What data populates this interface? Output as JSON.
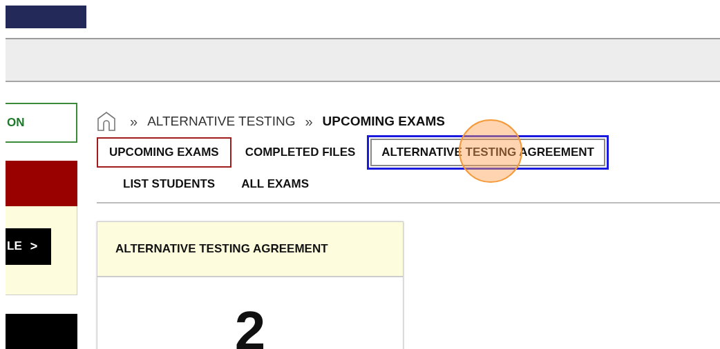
{
  "sidebar": {
    "outline_button": "ON",
    "panel_button": "LE",
    "panel_button_icon": ">"
  },
  "breadcrumb": [
    "ALTERNATIVE TESTING",
    "UPCOMING EXAMS"
  ],
  "breadcrumb_separator": "»",
  "tabs": [
    {
      "label": "UPCOMING EXAMS",
      "selected": true,
      "focused": false
    },
    {
      "label": "COMPLETED FILES",
      "selected": false,
      "focused": false
    },
    {
      "label": "ALTERNATIVE TESTING AGREEMENT",
      "selected": false,
      "focused": true
    },
    {
      "label": "LIST STUDENTS",
      "selected": false,
      "focused": false
    },
    {
      "label": "ALL EXAMS",
      "selected": false,
      "focused": false
    }
  ],
  "card": {
    "title": "ALTERNATIVE TESTING AGREEMENT",
    "count": "2"
  }
}
